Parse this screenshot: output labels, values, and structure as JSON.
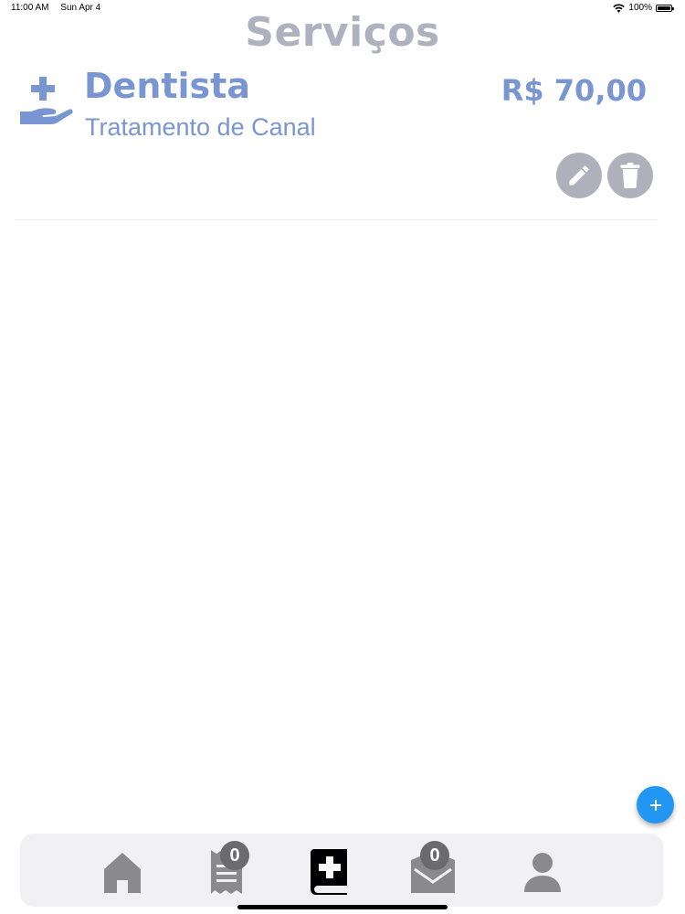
{
  "status_bar": {
    "time": "11:00 AM",
    "date": "Sun Apr 4",
    "battery": "100%",
    "battery_level": 1.0
  },
  "header": {
    "title": "Serviços"
  },
  "services": [
    {
      "name": "Dentista",
      "description": "Tratamento de Canal",
      "price": "R$ 70,00",
      "icon": "hand-holding-medical-icon"
    }
  ],
  "actions": {
    "edit_icon": "pencil-icon",
    "delete_icon": "trash-icon",
    "add_icon": "plus-icon"
  },
  "tab_bar": {
    "tabs": [
      {
        "name": "home",
        "icon": "home-icon",
        "active": false
      },
      {
        "name": "receipts",
        "icon": "receipt-icon",
        "badge": "0",
        "active": false
      },
      {
        "name": "services",
        "icon": "medical-book-icon",
        "active": true
      },
      {
        "name": "inbox",
        "icon": "envelope-open-icon",
        "badge": "0",
        "active": false
      },
      {
        "name": "profile",
        "icon": "user-icon",
        "active": false
      }
    ]
  },
  "colors": {
    "accent": "#7a96d2",
    "title": "#aeb2bf",
    "fab": "#2196f3",
    "tab_icon": "#8a8a8e",
    "tab_active": "#000000"
  }
}
